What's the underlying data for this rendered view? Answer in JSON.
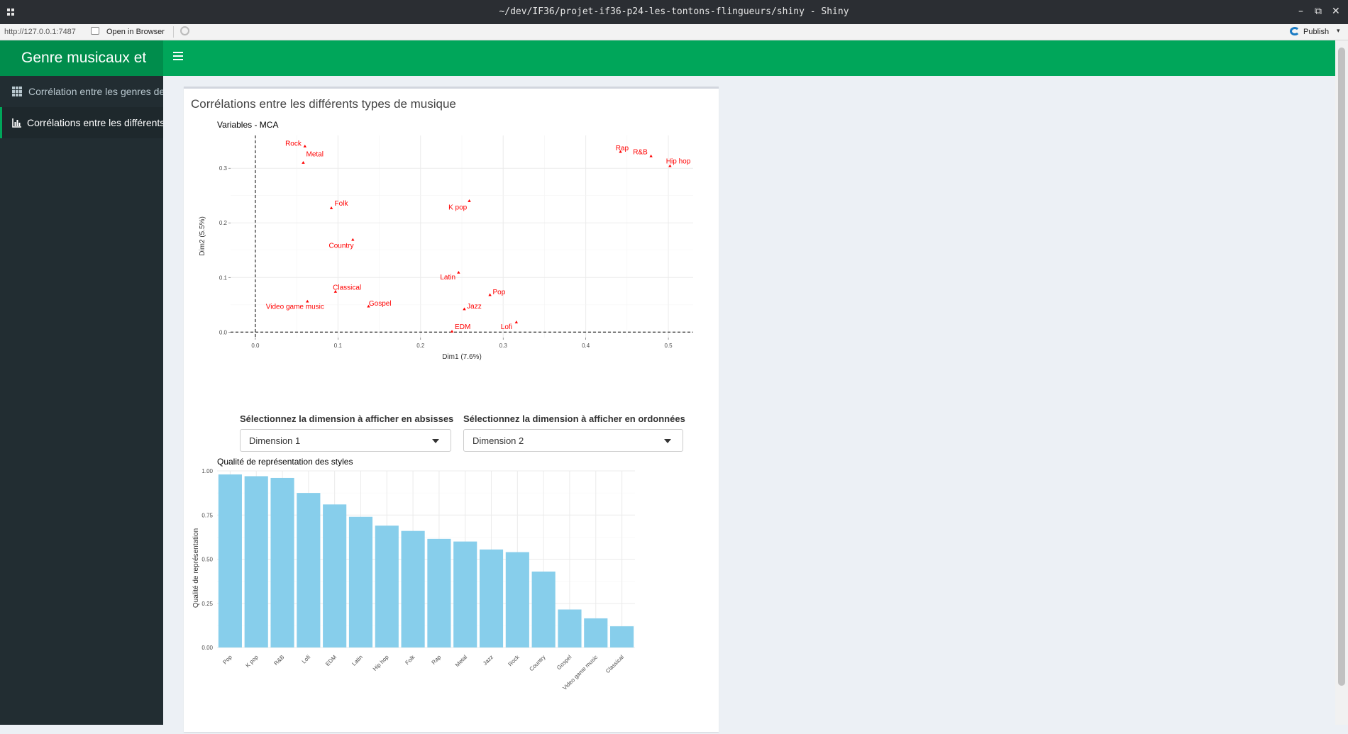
{
  "window": {
    "title": "~/dev/IF36/projet-if36-p24-les-tontons-flingueurs/shiny - Shiny"
  },
  "urlbar": {
    "url": "http://127.0.0.1:7487",
    "open_browser": "Open in Browser",
    "publish": "Publish"
  },
  "header": {
    "brand": "Genre musicaux et"
  },
  "sidebar": {
    "items": [
      {
        "label": "Corrélation entre les genres de musique",
        "active": false,
        "icon": "th-icon"
      },
      {
        "label": "Corrélations entre les différents styles",
        "active": true,
        "icon": "bar-chart-icon"
      }
    ]
  },
  "main": {
    "box_title": "Corrélations entre les différents types de musique",
    "x_select_label": "Sélectionnez la dimension à afficher en absisses",
    "x_select_value": "Dimension 1",
    "y_select_label": "Sélectionnez la dimension à afficher en ordonnées",
    "y_select_value": "Dimension 2"
  },
  "colors": {
    "header": "#00a65a",
    "sidebar": "#222d32",
    "mca_points": "#ff0000",
    "bars": "#87ceeb"
  },
  "chart_data": [
    {
      "type": "scatter",
      "title": "Variables - MCA",
      "xlabel": "Dim1 (7.6%)",
      "ylabel": "Dim2 (5.5%)",
      "xlim": [
        -0.03,
        0.53
      ],
      "ylim": [
        -0.01,
        0.36
      ],
      "xticks": [
        0.0,
        0.1,
        0.2,
        0.3,
        0.4,
        0.5
      ],
      "yticks": [
        0.0,
        0.1,
        0.2,
        0.3
      ],
      "xtick_labels": [
        "0.0",
        "0.1",
        "0.2",
        "0.3",
        "0.4",
        "0.5"
      ],
      "ytick_labels": [
        "0.0",
        "0.1",
        "0.2",
        "0.3"
      ],
      "grid": true,
      "points": [
        {
          "label": "Rock",
          "x": 0.06,
          "y": 0.34,
          "lx": -0.014,
          "ly": 0.006
        },
        {
          "label": "Metal",
          "x": 0.058,
          "y": 0.31,
          "lx": 0.014,
          "ly": 0.016
        },
        {
          "label": "Rap",
          "x": 0.442,
          "y": 0.33,
          "lx": 0.002,
          "ly": 0.007
        },
        {
          "label": "R&B",
          "x": 0.479,
          "y": 0.322,
          "lx": -0.013,
          "ly": 0.008
        },
        {
          "label": "Hip hop",
          "x": 0.502,
          "y": 0.304,
          "lx": 0.01,
          "ly": 0.009
        },
        {
          "label": "Folk",
          "x": 0.092,
          "y": 0.227,
          "lx": 0.012,
          "ly": 0.009
        },
        {
          "label": "K pop",
          "x": 0.259,
          "y": 0.24,
          "lx": -0.014,
          "ly": -0.011
        },
        {
          "label": "Country",
          "x": 0.118,
          "y": 0.169,
          "lx": -0.014,
          "ly": -0.01
        },
        {
          "label": "Latin",
          "x": 0.246,
          "y": 0.109,
          "lx": -0.013,
          "ly": -0.008
        },
        {
          "label": "Classical",
          "x": 0.097,
          "y": 0.074,
          "lx": 0.014,
          "ly": 0.008
        },
        {
          "label": "Pop",
          "x": 0.284,
          "y": 0.068,
          "lx": 0.011,
          "ly": 0.006
        },
        {
          "label": "Gospel",
          "x": 0.137,
          "y": 0.047,
          "lx": 0.014,
          "ly": 0.006
        },
        {
          "label": "Jazz",
          "x": 0.253,
          "y": 0.042,
          "lx": 0.012,
          "ly": 0.006
        },
        {
          "label": "Video game music",
          "x": 0.063,
          "y": 0.056,
          "lx": -0.015,
          "ly": -0.009
        },
        {
          "label": "EDM",
          "x": 0.238,
          "y": 0.001,
          "lx": 0.013,
          "ly": 0.009
        },
        {
          "label": "Lofi",
          "x": 0.316,
          "y": 0.018,
          "lx": -0.012,
          "ly": -0.008
        }
      ]
    },
    {
      "type": "bar",
      "title": "Qualité de représentation des styles",
      "xlabel": "",
      "ylabel": "Qualité de représentation",
      "ylim": [
        0,
        1.0
      ],
      "yticks": [
        0.0,
        0.25,
        0.5,
        0.75,
        1.0
      ],
      "ytick_labels": [
        "0.00",
        "0.25",
        "0.50",
        "0.75",
        "1.00"
      ],
      "categories": [
        "Pop",
        "K pop",
        "R&B",
        "Lofi",
        "EDM",
        "Latin",
        "Hip hop",
        "Folk",
        "Rap",
        "Metal",
        "Jazz",
        "Rock",
        "Country",
        "Gospel",
        "Video game music",
        "Classical"
      ],
      "values": [
        0.98,
        0.97,
        0.96,
        0.875,
        0.81,
        0.74,
        0.69,
        0.66,
        0.615,
        0.6,
        0.555,
        0.54,
        0.43,
        0.215,
        0.165,
        0.12
      ]
    }
  ]
}
